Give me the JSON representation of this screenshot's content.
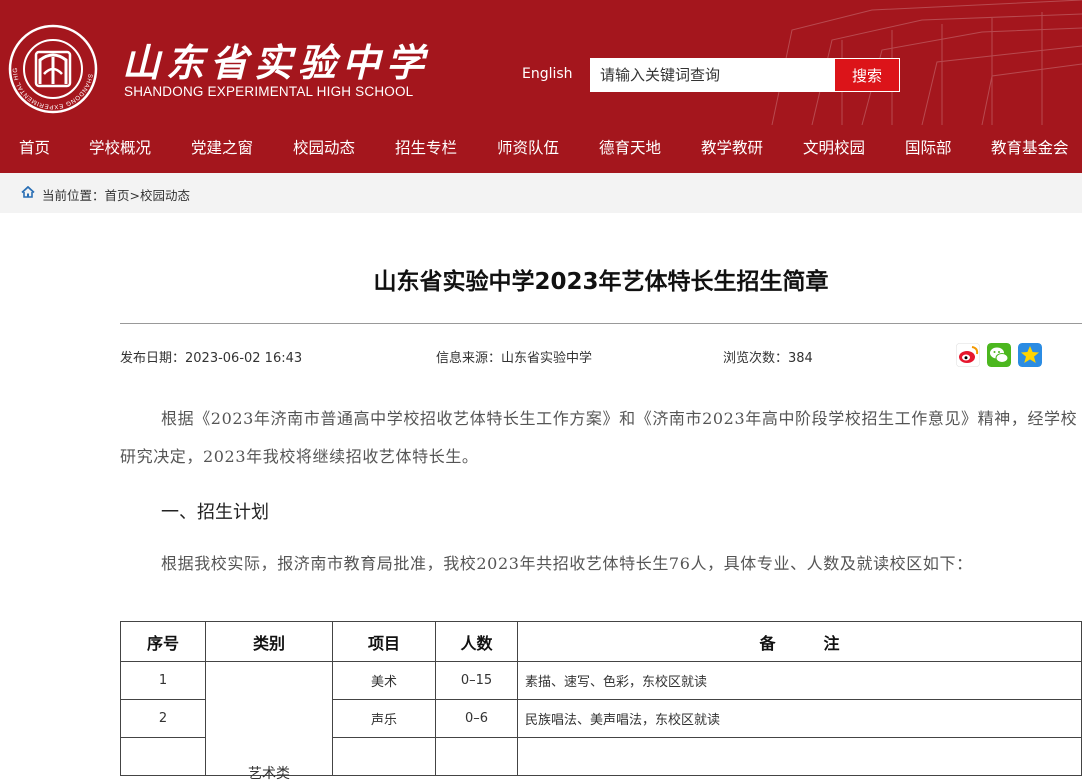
{
  "header": {
    "cn_name": "山东省实验中学",
    "en_name": "SHANDONG EXPERIMENTAL HIGH SCHOOL",
    "seal_text": "SHANDONG EXPERIMENTAL HIGH SCHOOL",
    "english_link": "English",
    "search": {
      "placeholder": "请输入关键词查询",
      "button": "搜索"
    },
    "colors": {
      "brand": "#a4161d",
      "search_button": "#dc1419"
    }
  },
  "nav": [
    "首页",
    "学校概况",
    "党建之窗",
    "校园动态",
    "招生专栏",
    "师资队伍",
    "德育天地",
    "教学教研",
    "文明校园",
    "国际部",
    "教育基金会"
  ],
  "breadcrumb": {
    "label": "当前位置：",
    "items": [
      "首页",
      "校园动态"
    ],
    "separator": ">"
  },
  "article": {
    "title": "山东省实验中学2023年艺体特长生招生简章",
    "date": "发布日期：2023-06-02 16:43",
    "source": "信息来源：山东省实验中学",
    "views": "浏览次数：384",
    "share_icons": [
      "weibo-icon",
      "wechat-icon",
      "favorite-icon"
    ],
    "intro": "根据《2023年济南市普通高中学校招收艺体特长生工作方案》和《济南市2023年高中阶段学校招生工作意见》精神，经学校研究决定，2023年我校将继续招收艺体特长生。",
    "section1": "一、招生计划",
    "plan": "根据我校实际，报济南市教育局批准，我校2023年共招收艺体特长生76人，具体专业、人数及就读校区如下："
  },
  "table": {
    "headers": [
      "序号",
      "类别",
      "项目",
      "人数",
      "备　　　注"
    ],
    "rows": [
      {
        "no": "1",
        "item": "美术",
        "count": "0–15",
        "note": "素描、速写、色彩，东校区就读"
      },
      {
        "no": "2",
        "item": "声乐",
        "count": "0–6",
        "note": "民族唱法、美声唱法，东校区就读"
      },
      {
        "no": "",
        "item": "",
        "count": "",
        "note": ""
      }
    ],
    "category": "艺术类"
  }
}
